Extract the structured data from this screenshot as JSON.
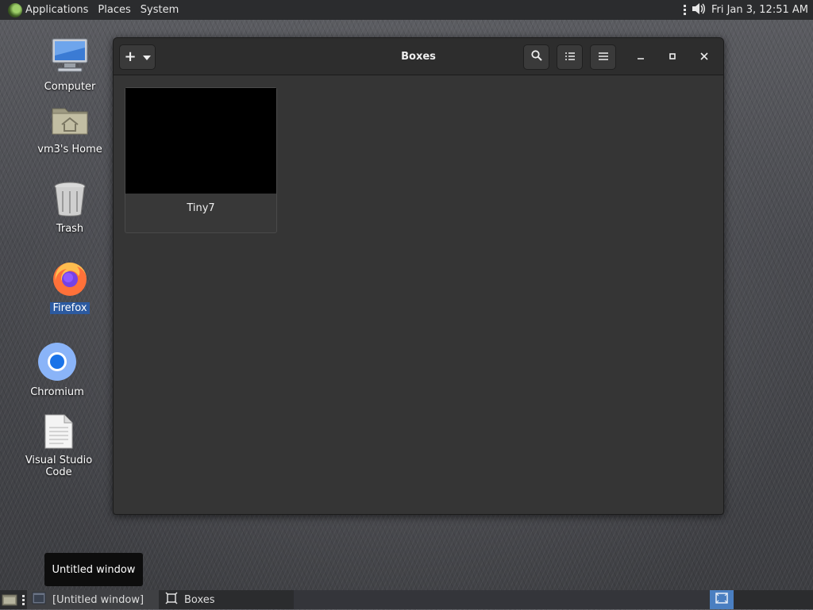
{
  "top_panel": {
    "menus": [
      "Applications",
      "Places",
      "System"
    ],
    "clock": "Fri Jan  3, 12:51 AM"
  },
  "desktop": {
    "icons": [
      {
        "label": "Computer",
        "icon": "computer-icon"
      },
      {
        "label": "vm3's Home",
        "icon": "home-folder-icon"
      },
      {
        "label": "Trash",
        "icon": "trash-icon"
      },
      {
        "label": "Firefox",
        "icon": "firefox-icon",
        "selected": true
      },
      {
        "label": "Chromium",
        "icon": "chromium-icon"
      },
      {
        "label": "Visual Studio Code",
        "icon": "document-icon"
      }
    ]
  },
  "window": {
    "title": "Boxes",
    "vms": [
      {
        "name": "Tiny7"
      }
    ]
  },
  "tooltip": "Untitled window",
  "taskbar": {
    "tasks": [
      {
        "label": "[Untitled window]",
        "icon": "window-icon",
        "active": true
      },
      {
        "label": "Boxes",
        "icon": "boxes-icon",
        "active": false
      }
    ]
  },
  "colors": {
    "panel": "#2b2c2e",
    "window_bg": "#353535",
    "headerbar": "#2d2d2d",
    "selection": "#2c5aa0"
  }
}
